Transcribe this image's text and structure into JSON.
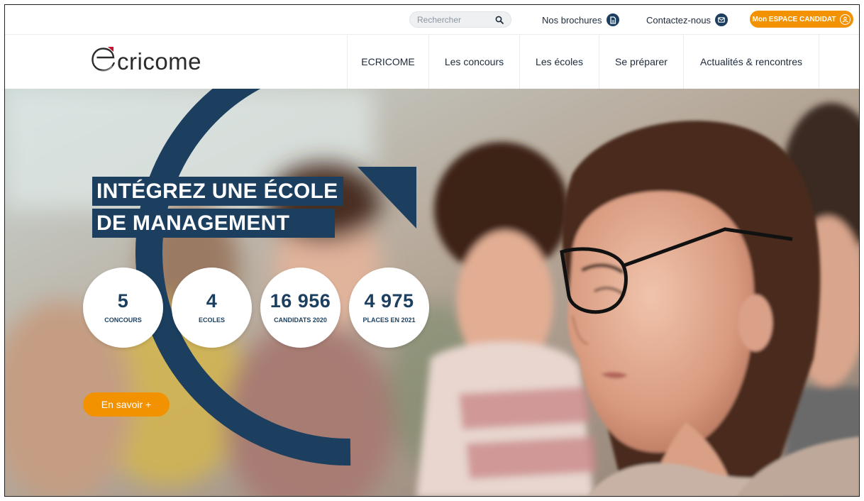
{
  "colors": {
    "navy": "#1c3f5f",
    "orange": "#f39200"
  },
  "topbar": {
    "search_placeholder": "Rechercher",
    "search_icon": "search-icon",
    "brochures_label": "Nos brochures",
    "brochures_icon": "document-icon",
    "contact_label": "Contactez-nous",
    "contact_icon": "mail-icon",
    "candidate_label": "Mon ESPACE CANDIDAT",
    "candidate_icon": "user-icon"
  },
  "logo": {
    "text": "cricome"
  },
  "nav": {
    "items": [
      {
        "label": "ECRICOME"
      },
      {
        "label": "Les concours"
      },
      {
        "label": "Les écoles"
      },
      {
        "label": "Se préparer"
      },
      {
        "label": "Actualités & rencontres"
      }
    ]
  },
  "hero": {
    "title_line1": "INTÉGREZ UNE ÉCOLE",
    "title_line2": "DE MANAGEMENT",
    "stats": [
      {
        "value": "5",
        "label": "CONCOURS"
      },
      {
        "value": "4",
        "label": "ECOLES"
      },
      {
        "value": "16 956",
        "label": "CANDIDATS 2020"
      },
      {
        "value": "4 975",
        "label": "PLACES EN 2021"
      }
    ],
    "cta_label": "En savoir +"
  }
}
